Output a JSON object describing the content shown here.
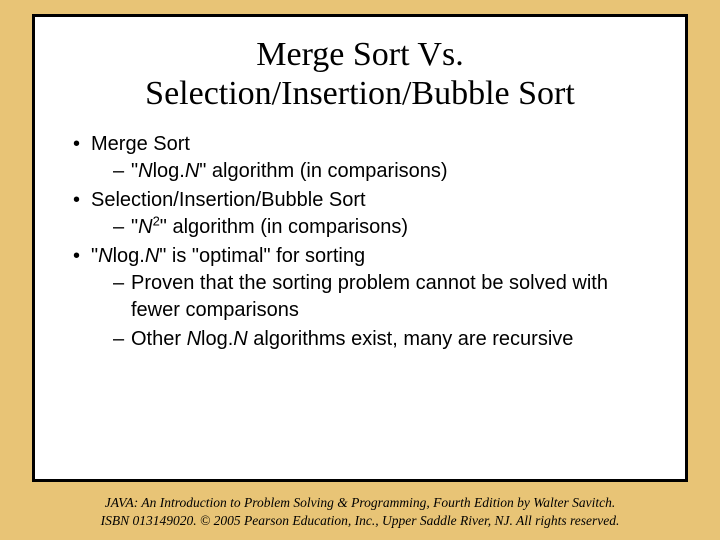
{
  "title_line1": "Merge Sort Vs.",
  "title_line2": "Selection/Insertion/Bubble Sort",
  "bullets": {
    "b1": "Merge Sort",
    "b1_sub1_prefix": "\"",
    "b1_sub1_n1": "N",
    "b1_sub1_mid": "log.",
    "b1_sub1_n2": "N",
    "b1_sub1_suffix": "\" algorithm (in comparisons)",
    "b2": "Selection/Insertion/Bubble Sort",
    "b2_sub1_prefix": "\"",
    "b2_sub1_n": "N",
    "b2_sub1_exp": "2",
    "b2_sub1_suffix": "\" algorithm (in comparisons)",
    "b3_prefix": "\"",
    "b3_n1": "N",
    "b3_mid": "log.",
    "b3_n2": "N",
    "b3_suffix": "\" is \"optimal\" for sorting",
    "b3_sub1": "Proven that the sorting problem cannot be solved with fewer comparisons",
    "b3_sub2_prefix": "Other ",
    "b3_sub2_n1": "N",
    "b3_sub2_mid": "log.",
    "b3_sub2_n2": "N",
    "b3_sub2_suffix": " algorithms exist, many are recursive"
  },
  "footer_line1": "JAVA: An Introduction to Problem Solving & Programming, Fourth Edition by Walter Savitch.",
  "footer_line2": "ISBN 013149020. © 2005 Pearson Education, Inc., Upper Saddle River, NJ. All rights reserved."
}
